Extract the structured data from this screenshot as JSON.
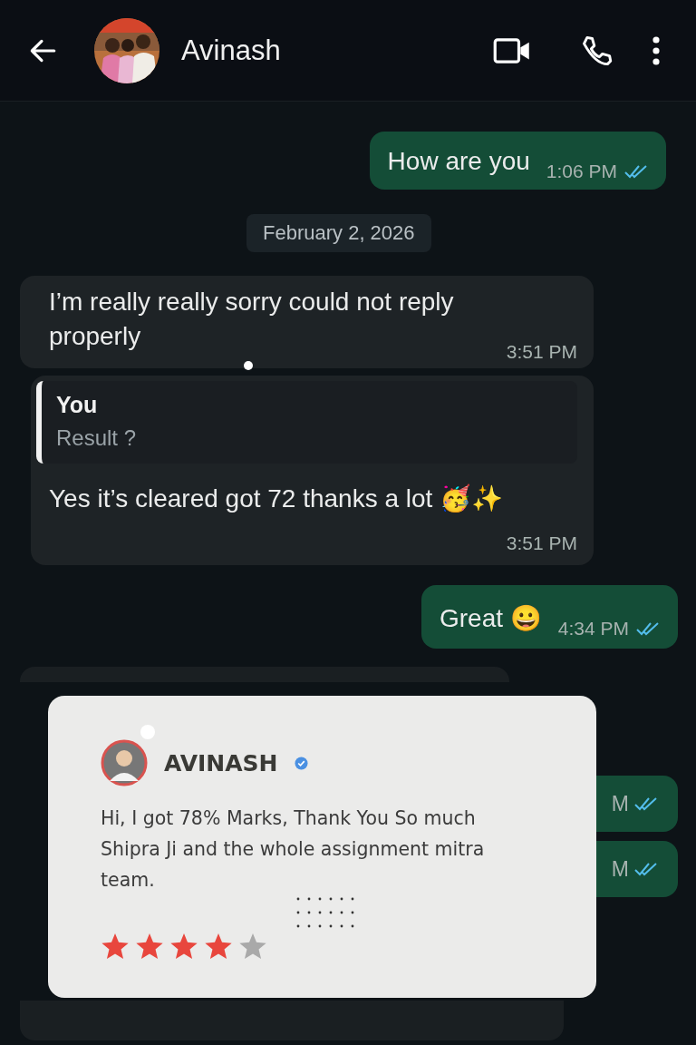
{
  "header": {
    "contact_name": "Avinash"
  },
  "messages": [
    {
      "kind": "outgoing",
      "text": "How are you",
      "time": "1:06 PM",
      "read": true
    },
    {
      "kind": "date",
      "text": "February 2, 2026"
    },
    {
      "kind": "incoming",
      "text": "I’m really really sorry could not reply properly",
      "time": "3:51 PM"
    },
    {
      "kind": "incoming",
      "quote": {
        "author": "You",
        "text": "Result ?"
      },
      "text": "Yes it’s cleared got 72 thanks a lot 🥳✨",
      "time": "3:51 PM"
    },
    {
      "kind": "outgoing",
      "text": "Great 😀",
      "time": "4:34 PM",
      "read": true
    },
    {
      "kind": "covered_incoming"
    },
    {
      "kind": "covered_outgoing",
      "time": "M",
      "read": true
    },
    {
      "kind": "covered_outgoing",
      "time": "M",
      "read": true
    },
    {
      "kind": "covered_incoming"
    }
  ],
  "review_card": {
    "name": "AVINASH",
    "verified": true,
    "text": "Hi, I got 78% Marks, Thank You So much Shipra Ji and the whole assignment mitra team.",
    "stars": 4
  }
}
